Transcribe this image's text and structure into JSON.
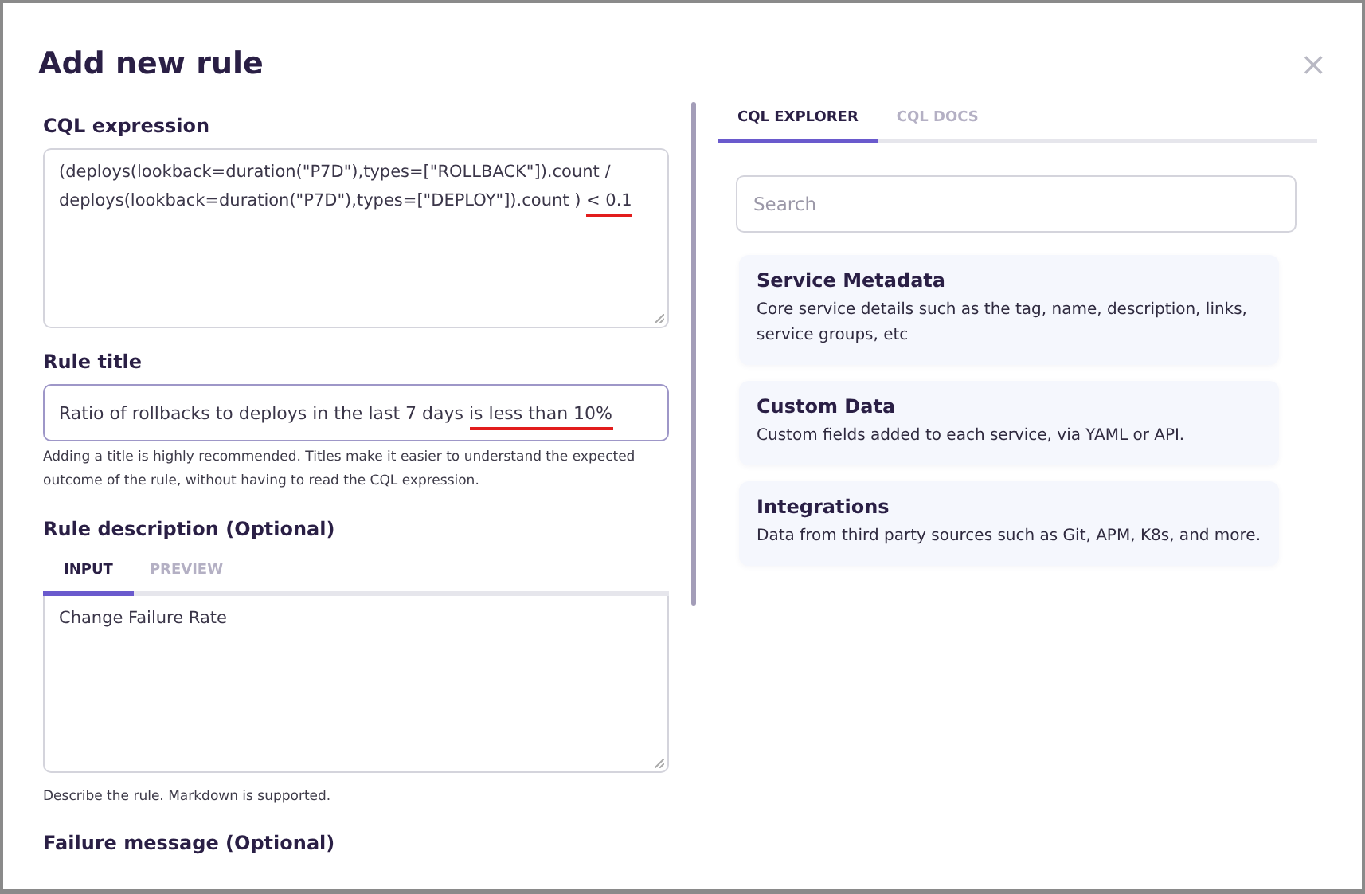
{
  "dialog": {
    "title": "Add new rule",
    "close_icon": "×"
  },
  "cql_expression": {
    "label": "CQL expression",
    "segments": [
      {
        "text": "(deploys(lookback=duration(\"P7D\"),types=[\"ROLLBACK\"]).count / deploys(lookback=duration(\"P7D\"),types=[\"DEPLOY\"]).count ) ",
        "underlined": false
      },
      {
        "text": "< 0.1",
        "underlined": true
      }
    ]
  },
  "rule_title": {
    "label": "Rule title",
    "segments": [
      {
        "text": "Ratio of rollbacks to deploys in the last 7 days ",
        "underlined": false
      },
      {
        "text": "is less than 10%",
        "underlined": true
      }
    ],
    "help": "Adding a title is highly recommended. Titles make it easier to understand the expected outcome of the rule, without having to read the CQL expression."
  },
  "rule_description": {
    "label": "Rule description (Optional)",
    "tabs": [
      {
        "label": "INPUT",
        "selected": true
      },
      {
        "label": "PREVIEW",
        "selected": false
      }
    ],
    "value": "Change Failure Rate",
    "help": "Describe the rule. Markdown is supported."
  },
  "failure_message": {
    "label": "Failure message (Optional)"
  },
  "explorer": {
    "tabs": [
      {
        "label": "CQL EXPLORER",
        "selected": true
      },
      {
        "label": "CQL DOCS",
        "selected": false
      }
    ],
    "search": {
      "placeholder": "Search"
    },
    "cards": [
      {
        "title": "Service Metadata",
        "description": "Core service details such as the tag, name, description, links, service groups, etc"
      },
      {
        "title": "Custom Data",
        "description": "Custom fields added to each service, via YAML or API."
      },
      {
        "title": "Integrations",
        "description": "Data from third party sources such as Git, APM, K8s, and more."
      }
    ]
  }
}
